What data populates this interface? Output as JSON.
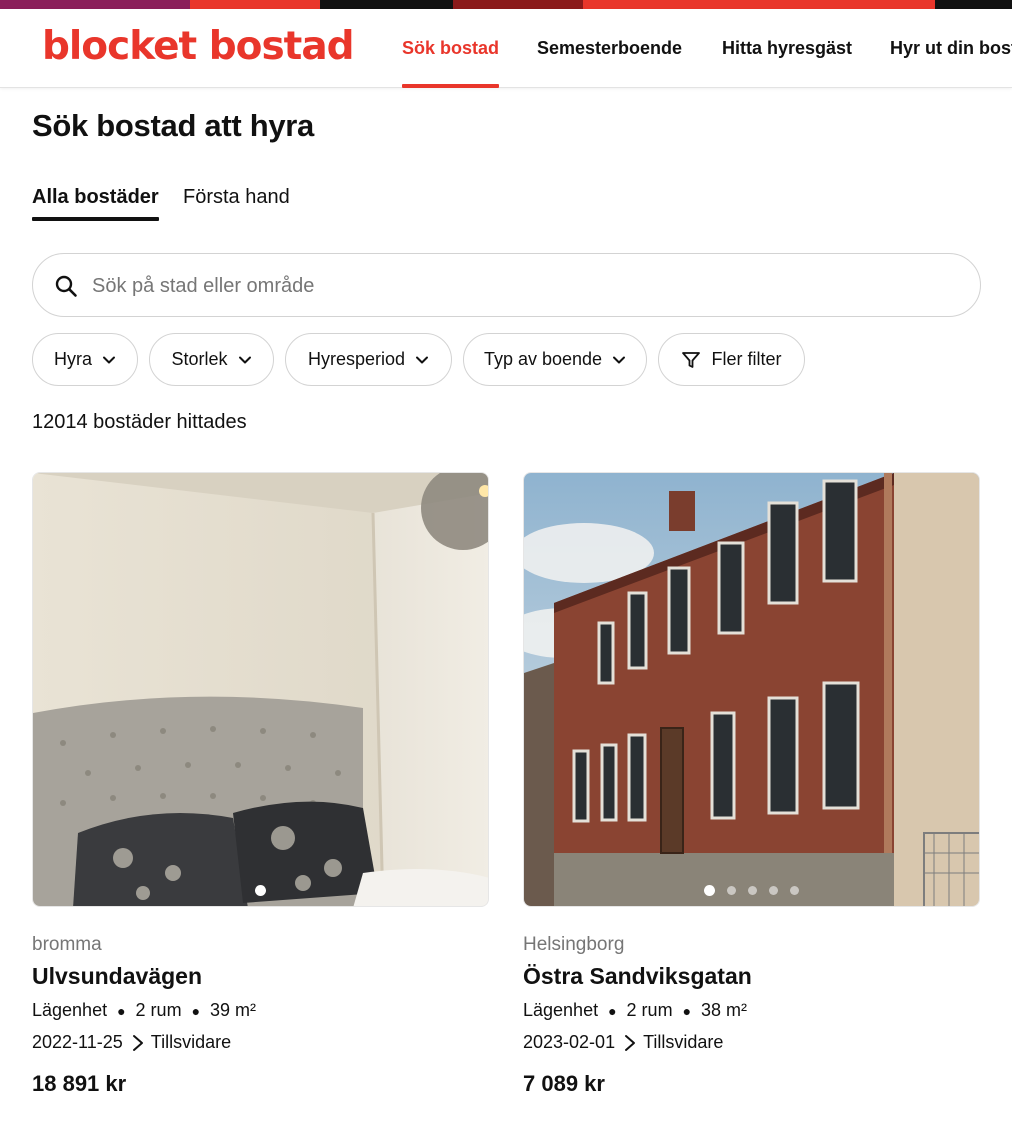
{
  "header": {
    "logo": "blocket bostad",
    "nav": [
      {
        "label": "Sök bostad",
        "active": true
      },
      {
        "label": "Semesterboende",
        "active": false
      },
      {
        "label": "Hitta hyresgäst",
        "active": false
      },
      {
        "label": "Hyr ut din bostad",
        "active": false
      }
    ]
  },
  "colors": {
    "accent": "#e9362b",
    "stripe": [
      "#8b1f5a",
      "#e9362b",
      "#111111",
      "#8b1a1a",
      "#e9362b",
      "#111111"
    ]
  },
  "page_title": "Sök bostad att hyra",
  "tabs": [
    {
      "label": "Alla bostäder",
      "active": true
    },
    {
      "label": "Första hand",
      "active": false
    }
  ],
  "search": {
    "icon": "search-icon",
    "placeholder": "Sök på stad eller område",
    "value": ""
  },
  "filters": [
    {
      "label": "Hyra",
      "icon": "chevron-down-icon"
    },
    {
      "label": "Storlek",
      "icon": "chevron-down-icon"
    },
    {
      "label": "Hyresperiod",
      "icon": "chevron-down-icon"
    },
    {
      "label": "Typ av boende",
      "icon": "chevron-down-icon"
    },
    {
      "label": "Fler filter",
      "icon": "filter-icon"
    }
  ],
  "result_count": "12014 bostäder hittades",
  "listings": [
    {
      "location": "bromma",
      "street": "Ulvsundavägen",
      "type": "Lägenhet",
      "rooms": "2 rum",
      "area": "39 m²",
      "from_date": "2022-11-25",
      "to_date": "Tillsvidare",
      "price": "18 891 kr",
      "image_dots": 1,
      "active_dot": 0
    },
    {
      "location": "Helsingborg",
      "street": "Östra Sandviksgatan",
      "type": "Lägenhet",
      "rooms": "2 rum",
      "area": "38 m²",
      "from_date": "2023-02-01",
      "to_date": "Tillsvidare",
      "price": "7 089 kr",
      "image_dots": 5,
      "active_dot": 0
    }
  ]
}
